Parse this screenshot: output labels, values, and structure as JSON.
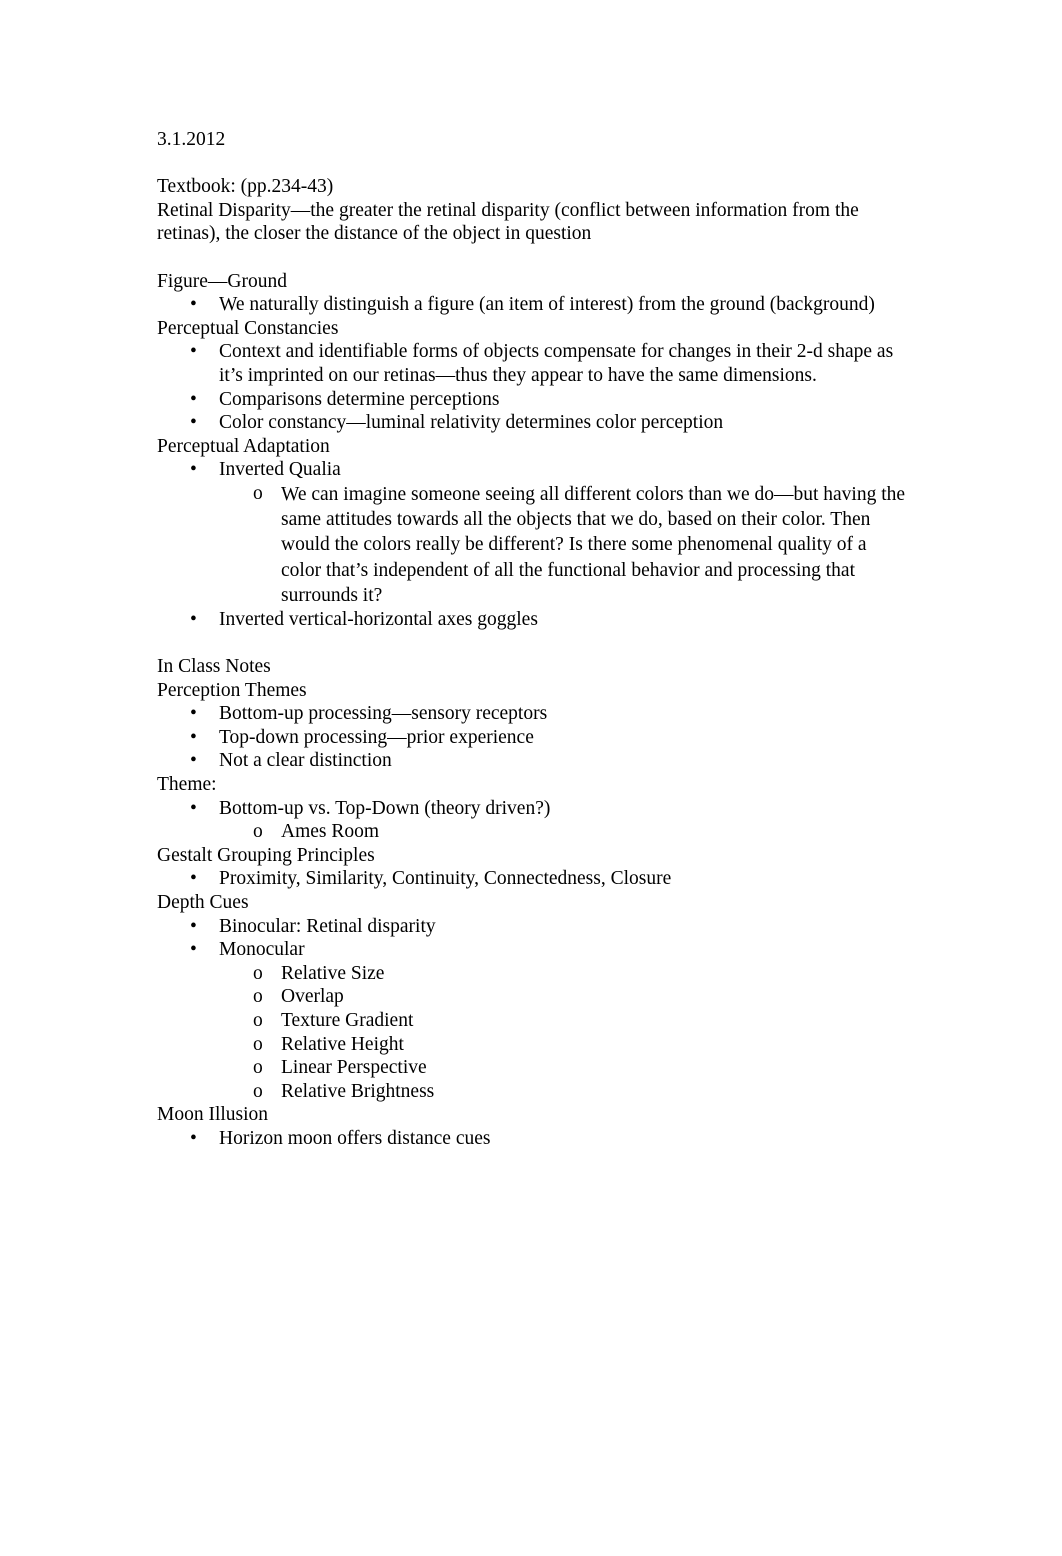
{
  "document": {
    "date": "3.1.2012",
    "markers": {
      "disc": "•",
      "circle": "o"
    },
    "sections": {
      "textbook": {
        "heading": "Textbook: (pp.234-43)",
        "retinal_disparity": "Retinal Disparity—the greater the retinal disparity (conflict between information from the retinas), the closer the distance of the object in question"
      },
      "figure_ground": {
        "heading": "Figure—Ground",
        "bullets": [
          "We naturally distinguish a figure (an item of interest) from the ground (background)"
        ]
      },
      "perceptual_constancies": {
        "heading": "Perceptual Constancies",
        "bullets": [
          "Context and identifiable forms of objects compensate for changes in their 2-d shape as it’s imprinted on our retinas—thus they appear to have the same dimensions.",
          "Comparisons determine perceptions",
          "Color constancy—luminal relativity determines color perception"
        ]
      },
      "perceptual_adaptation": {
        "heading": "Perceptual Adaptation",
        "bullets": [
          "Inverted Qualia",
          "Inverted vertical-horizontal axes goggles"
        ],
        "subbullets": [
          "We can imagine someone seeing all different colors than we do—but having the same attitudes towards all the objects that we do, based on their color. Then would the colors really be different? Is there some phenomenal quality of a color that’s independent of all the functional behavior and processing that surrounds it?"
        ]
      },
      "in_class_notes": {
        "heading": "In Class Notes"
      },
      "perception_themes": {
        "heading": "Perception Themes",
        "bullets": [
          "Bottom-up processing—sensory receptors",
          "Top-down processing—prior experience",
          "Not a clear distinction"
        ]
      },
      "theme": {
        "heading": "Theme:",
        "bullets": [
          "Bottom-up vs. Top-Down (theory driven?)"
        ],
        "subbullets": [
          "Ames Room"
        ]
      },
      "gestalt": {
        "heading": "Gestalt Grouping Principles",
        "bullets": [
          "Proximity, Similarity, Continuity, Connectedness, Closure"
        ]
      },
      "depth_cues": {
        "heading": "Depth Cues",
        "bullets": [
          "Binocular: Retinal disparity",
          "Monocular"
        ],
        "monocular_subbullets": [
          "Relative Size",
          "Overlap",
          "Texture Gradient",
          "Relative Height",
          "Linear Perspective",
          "Relative Brightness"
        ]
      },
      "moon_illusion": {
        "heading": "Moon Illusion",
        "bullets": [
          "Horizon moon offers distance cues"
        ]
      }
    }
  }
}
